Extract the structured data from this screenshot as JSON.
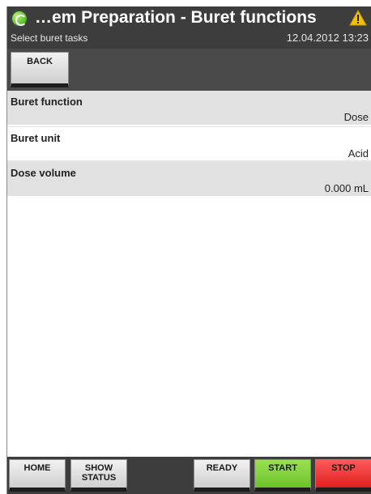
{
  "header": {
    "title": "…em Preparation - Buret functions",
    "subtitle": "Select buret tasks",
    "datetime": "12.04.2012 13:23",
    "app_icon": "recycle-arrows-icon",
    "warning_icon": "warning-triangle-icon"
  },
  "toolbar": {
    "back_label": "BACK"
  },
  "rows": [
    {
      "label": "Buret function",
      "value": "Dose"
    },
    {
      "label": "Buret unit",
      "value": "Acid"
    },
    {
      "label": "Dose volume",
      "value": "0.000 mL"
    }
  ],
  "bottombar": {
    "home_label": "HOME",
    "show_status_label": "SHOW STATUS",
    "ready_label": "READY",
    "start_label": "START",
    "stop_label": "STOP"
  },
  "colors": {
    "header_bg": "#3d3d3d",
    "start_green": "#7ed23a",
    "stop_red": "#f03a3a",
    "warning_yellow": "#f2c200"
  }
}
